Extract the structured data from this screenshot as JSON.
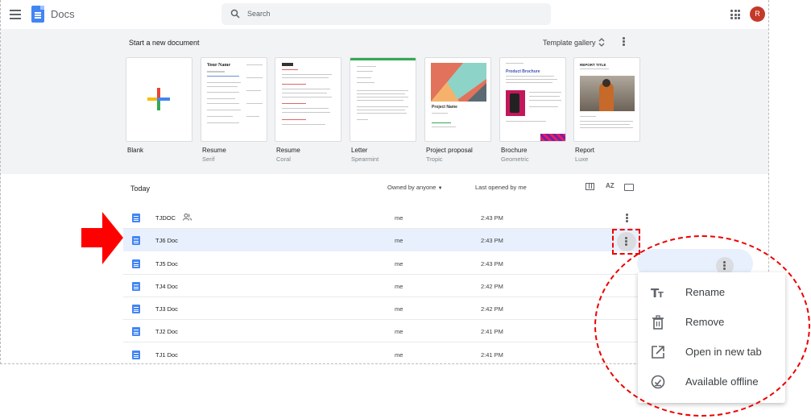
{
  "topbar": {
    "app_title": "Docs",
    "search_placeholder": "Search",
    "avatar_initial": "R"
  },
  "templates": {
    "heading": "Start a new document",
    "gallery_label": "Template gallery",
    "items": [
      {
        "name": "Blank",
        "sub": ""
      },
      {
        "name": "Resume",
        "sub": "Serif"
      },
      {
        "name": "Resume",
        "sub": "Coral"
      },
      {
        "name": "Letter",
        "sub": "Spearmint"
      },
      {
        "name": "Project proposal",
        "sub": "Tropic"
      },
      {
        "name": "Brochure",
        "sub": "Geometric"
      },
      {
        "name": "Report",
        "sub": "Luxe"
      }
    ],
    "card_text": {
      "resume_title": "Your Name",
      "proposal_title": "Project Name",
      "brochure_title": "Product Brochure",
      "report_title": "REPORT TITLE"
    }
  },
  "list": {
    "section": "Today",
    "owner_filter": "Owned by anyone",
    "sort_label": "Last opened by me",
    "sort_icon": "AZ",
    "rows": [
      {
        "name": "TJDOC",
        "owner": "me",
        "time": "2:43 PM",
        "shared": true
      },
      {
        "name": "TJ6 Doc",
        "owner": "me",
        "time": "2:43 PM",
        "shared": false
      },
      {
        "name": "TJ5 Doc",
        "owner": "me",
        "time": "2:43 PM",
        "shared": false
      },
      {
        "name": "TJ4 Doc",
        "owner": "me",
        "time": "2:42 PM",
        "shared": false
      },
      {
        "name": "TJ3 Doc",
        "owner": "me",
        "time": "2:42 PM",
        "shared": false
      },
      {
        "name": "TJ2 Doc",
        "owner": "me",
        "time": "2:41 PM",
        "shared": false
      },
      {
        "name": "TJ1 Doc",
        "owner": "me",
        "time": "2:41 PM",
        "shared": false
      }
    ]
  },
  "context_menu": {
    "items": [
      {
        "label": "Rename",
        "icon": "text-icon"
      },
      {
        "label": "Remove",
        "icon": "trash-icon"
      },
      {
        "label": "Open in new tab",
        "icon": "open-external-icon"
      },
      {
        "label": "Available offline",
        "icon": "offline-check-icon"
      }
    ]
  },
  "colors": {
    "accent": "#4285f4",
    "annotation": "#e00000",
    "selected_row": "#e8f0fe"
  }
}
